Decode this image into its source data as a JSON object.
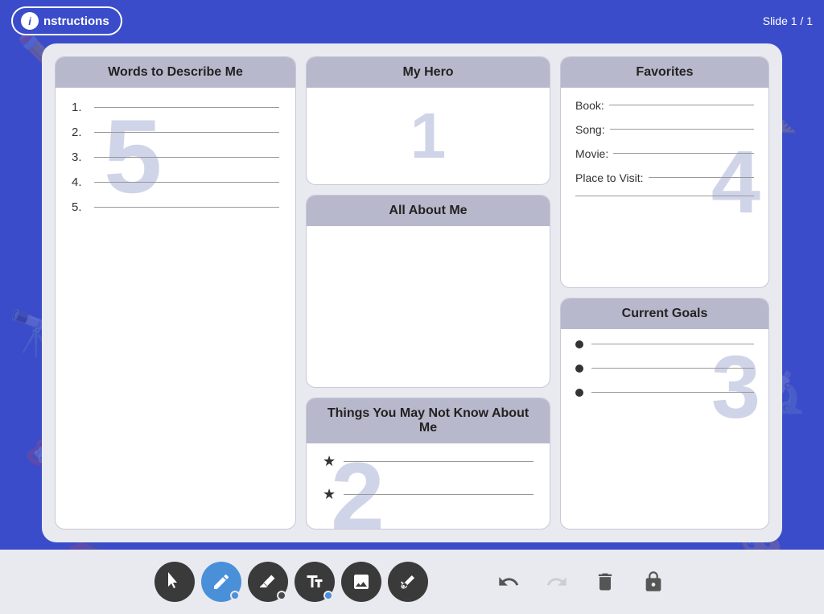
{
  "topBar": {
    "instructionsLabel": "nstructions",
    "slideIndicator": "Slide 1 / 1"
  },
  "slide": {
    "wordsToDescribeMe": {
      "title": "Words to Describe Me",
      "watermark": "5",
      "items": [
        {
          "num": "1."
        },
        {
          "num": "2."
        },
        {
          "num": "3."
        },
        {
          "num": "4."
        },
        {
          "num": "5."
        }
      ]
    },
    "myHero": {
      "title": "My Hero",
      "watermark": "1"
    },
    "allAboutMe": {
      "title": "All About Me"
    },
    "favorites": {
      "title": "Favorites",
      "watermark": "4",
      "items": [
        {
          "label": "Book:"
        },
        {
          "label": "Song:"
        },
        {
          "label": "Movie:"
        },
        {
          "label": "Place to Visit:"
        }
      ]
    },
    "thingsYouMayNotKnow": {
      "title": "Things You May Not Know About Me",
      "watermark": "2",
      "items": [
        {
          "star": "★"
        },
        {
          "star": "★"
        }
      ]
    },
    "currentGoals": {
      "title": "Current Goals",
      "watermark": "3",
      "items": [
        {},
        {},
        {}
      ]
    }
  },
  "toolbar": {
    "tools": [
      {
        "id": "cursor",
        "label": "Cursor",
        "icon": "cursor"
      },
      {
        "id": "pen",
        "label": "Pen",
        "icon": "pen",
        "active": true
      },
      {
        "id": "eraser",
        "label": "Eraser",
        "icon": "eraser"
      },
      {
        "id": "text",
        "label": "Text",
        "icon": "text"
      },
      {
        "id": "image",
        "label": "Image",
        "icon": "image"
      },
      {
        "id": "shape-eraser",
        "label": "Shape Eraser",
        "icon": "shape-eraser"
      }
    ],
    "actions": [
      {
        "id": "undo",
        "label": "Undo",
        "icon": "undo"
      },
      {
        "id": "redo",
        "label": "Redo",
        "icon": "redo",
        "disabled": true
      },
      {
        "id": "delete",
        "label": "Delete",
        "icon": "delete"
      },
      {
        "id": "lock",
        "label": "Lock",
        "icon": "lock"
      }
    ]
  }
}
